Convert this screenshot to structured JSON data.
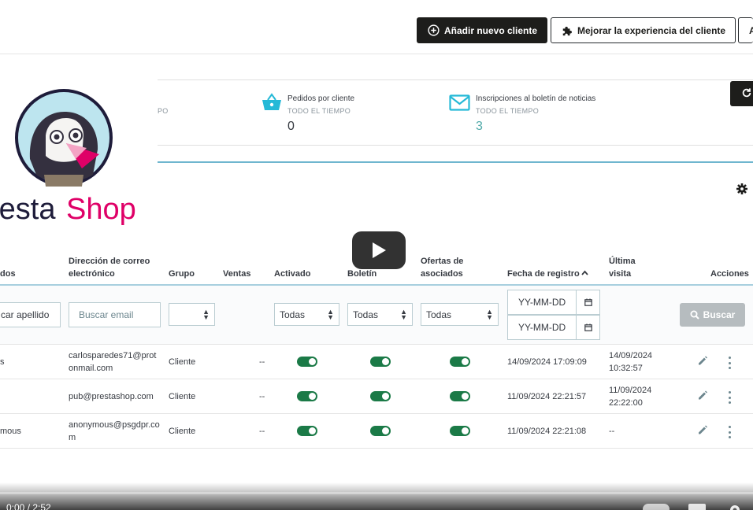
{
  "header": {
    "add_button_label": "Añadir nuevo cliente",
    "improve_button_label": "Mejorar la experiencia del cliente",
    "more_button_label": "A"
  },
  "kpis": [
    {
      "title": "",
      "subtitle": "PO",
      "value": ""
    },
    {
      "title": "Pedidos por cliente",
      "subtitle": "TODO EL TIEMPO",
      "value": "0"
    },
    {
      "title": "Inscripciones al boletín de noticias",
      "subtitle": "TODO EL TIEMPO",
      "value": "3"
    }
  ],
  "logo": {
    "text_left": "resta",
    "text_right": "Shop"
  },
  "table": {
    "headers": {
      "lastname": "dos",
      "email": "Dirección de correo electrónico",
      "group": "Grupo",
      "sales": "Ventas",
      "enabled": "Activado",
      "newsletter": "Boletín",
      "optin": "Ofertas de asociados",
      "date_add": "Fecha de registro",
      "last_visit": "Última visita",
      "actions": "Acciones"
    },
    "filters": {
      "lastname_placeholder": "car apellido",
      "email_placeholder": "Buscar email",
      "group_value": "",
      "enabled_value": "Todas",
      "newsletter_value": "Todas",
      "optin_value": "Todas",
      "date_from_placeholder": "YY-MM-DD",
      "date_to_placeholder": "YY-MM-DD",
      "search_label": "Buscar"
    },
    "rows": [
      {
        "lastname": "s",
        "email": "carlosparedes71@protonmail.com",
        "group": "Cliente",
        "sales": "--",
        "date_add": "14/09/2024 17:09:09",
        "last_visit": "14/09/2024 10:32:57",
        "enabled": true,
        "newsletter": true,
        "optin": true
      },
      {
        "lastname": "",
        "email": "pub@prestashop.com",
        "group": "Cliente",
        "sales": "--",
        "date_add": "11/09/2024 22:21:57",
        "last_visit": "11/09/2024 22:22:00",
        "enabled": true,
        "newsletter": true,
        "optin": true
      },
      {
        "lastname": "mous",
        "email": "anonymous@psgdpr.com",
        "group": "Cliente",
        "sales": "--",
        "date_add": "11/09/2024 22:21:08",
        "last_visit": "--",
        "enabled": true,
        "newsletter": true,
        "optin": true
      }
    ]
  },
  "player": {
    "time": "0:00 / 2:52"
  }
}
